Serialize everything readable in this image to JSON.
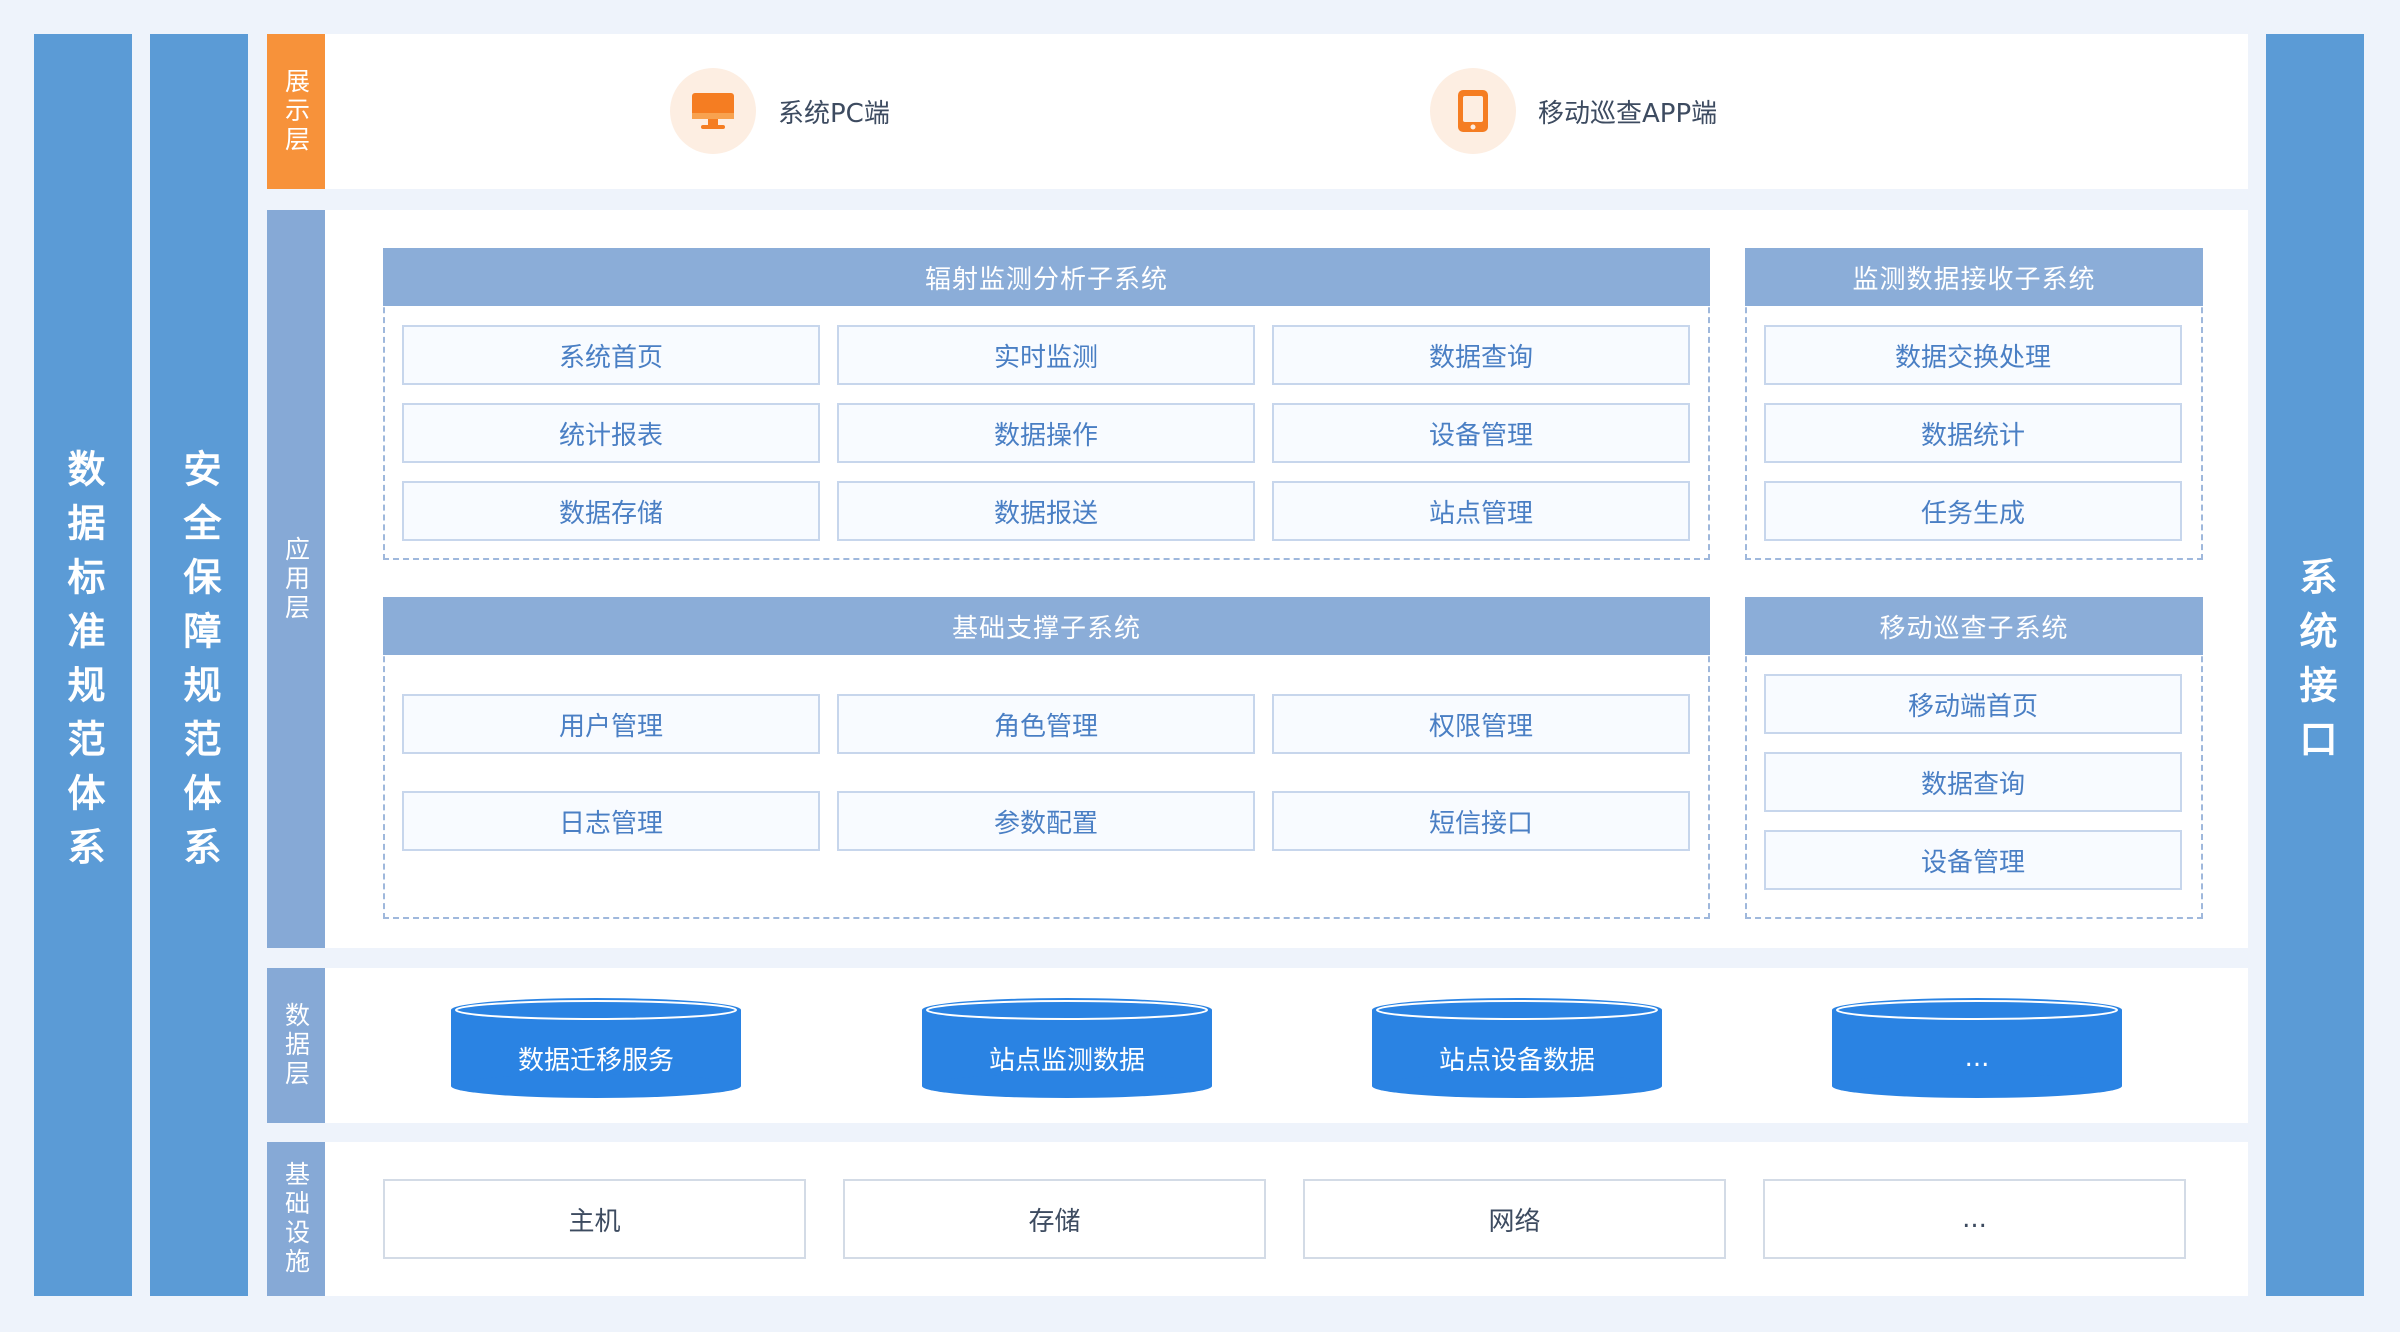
{
  "left_pillars": [
    {
      "label": "数据标准规范体系"
    },
    {
      "label": "安全保障规范体系"
    }
  ],
  "right_pillar": {
    "label": "系统接口"
  },
  "layers": {
    "presentation": {
      "label": "展示层",
      "items": [
        {
          "label": "系统PC端",
          "icon": "monitor-icon"
        },
        {
          "label": "移动巡查APP端",
          "icon": "tablet-icon"
        }
      ]
    },
    "application": {
      "label": "应用层",
      "subsystems": [
        {
          "title": "辐射监测分析子系统",
          "modules": [
            "系统首页",
            "实时监测",
            "数据查询",
            "统计报表",
            "数据操作",
            "设备管理",
            "数据存储",
            "数据报送",
            "站点管理"
          ]
        },
        {
          "title": "监测数据接收子系统",
          "modules": [
            "数据交换处理",
            "数据统计",
            "任务生成"
          ]
        },
        {
          "title": "基础支撑子系统",
          "modules": [
            "用户管理",
            "角色管理",
            "权限管理",
            "日志管理",
            "参数配置",
            "短信接口"
          ]
        },
        {
          "title": "移动巡查子系统",
          "modules": [
            "移动端首页",
            "数据查询",
            "设备管理"
          ]
        }
      ]
    },
    "data": {
      "label": "数据层",
      "items": [
        "数据迁移服务",
        "站点监测数据",
        "站点设备数据",
        "..."
      ]
    },
    "infrastructure": {
      "label": "基础设施",
      "items": [
        "主机",
        "存储",
        "网络",
        "..."
      ]
    }
  },
  "colors": {
    "pillar": "#5b9bd6",
    "presentation_label": "#f7923a",
    "layer_label": "#86a9d6",
    "subsystem_header": "#8badd8",
    "cylinder": "#2a83e3",
    "icon_accent": "#f57d22"
  }
}
